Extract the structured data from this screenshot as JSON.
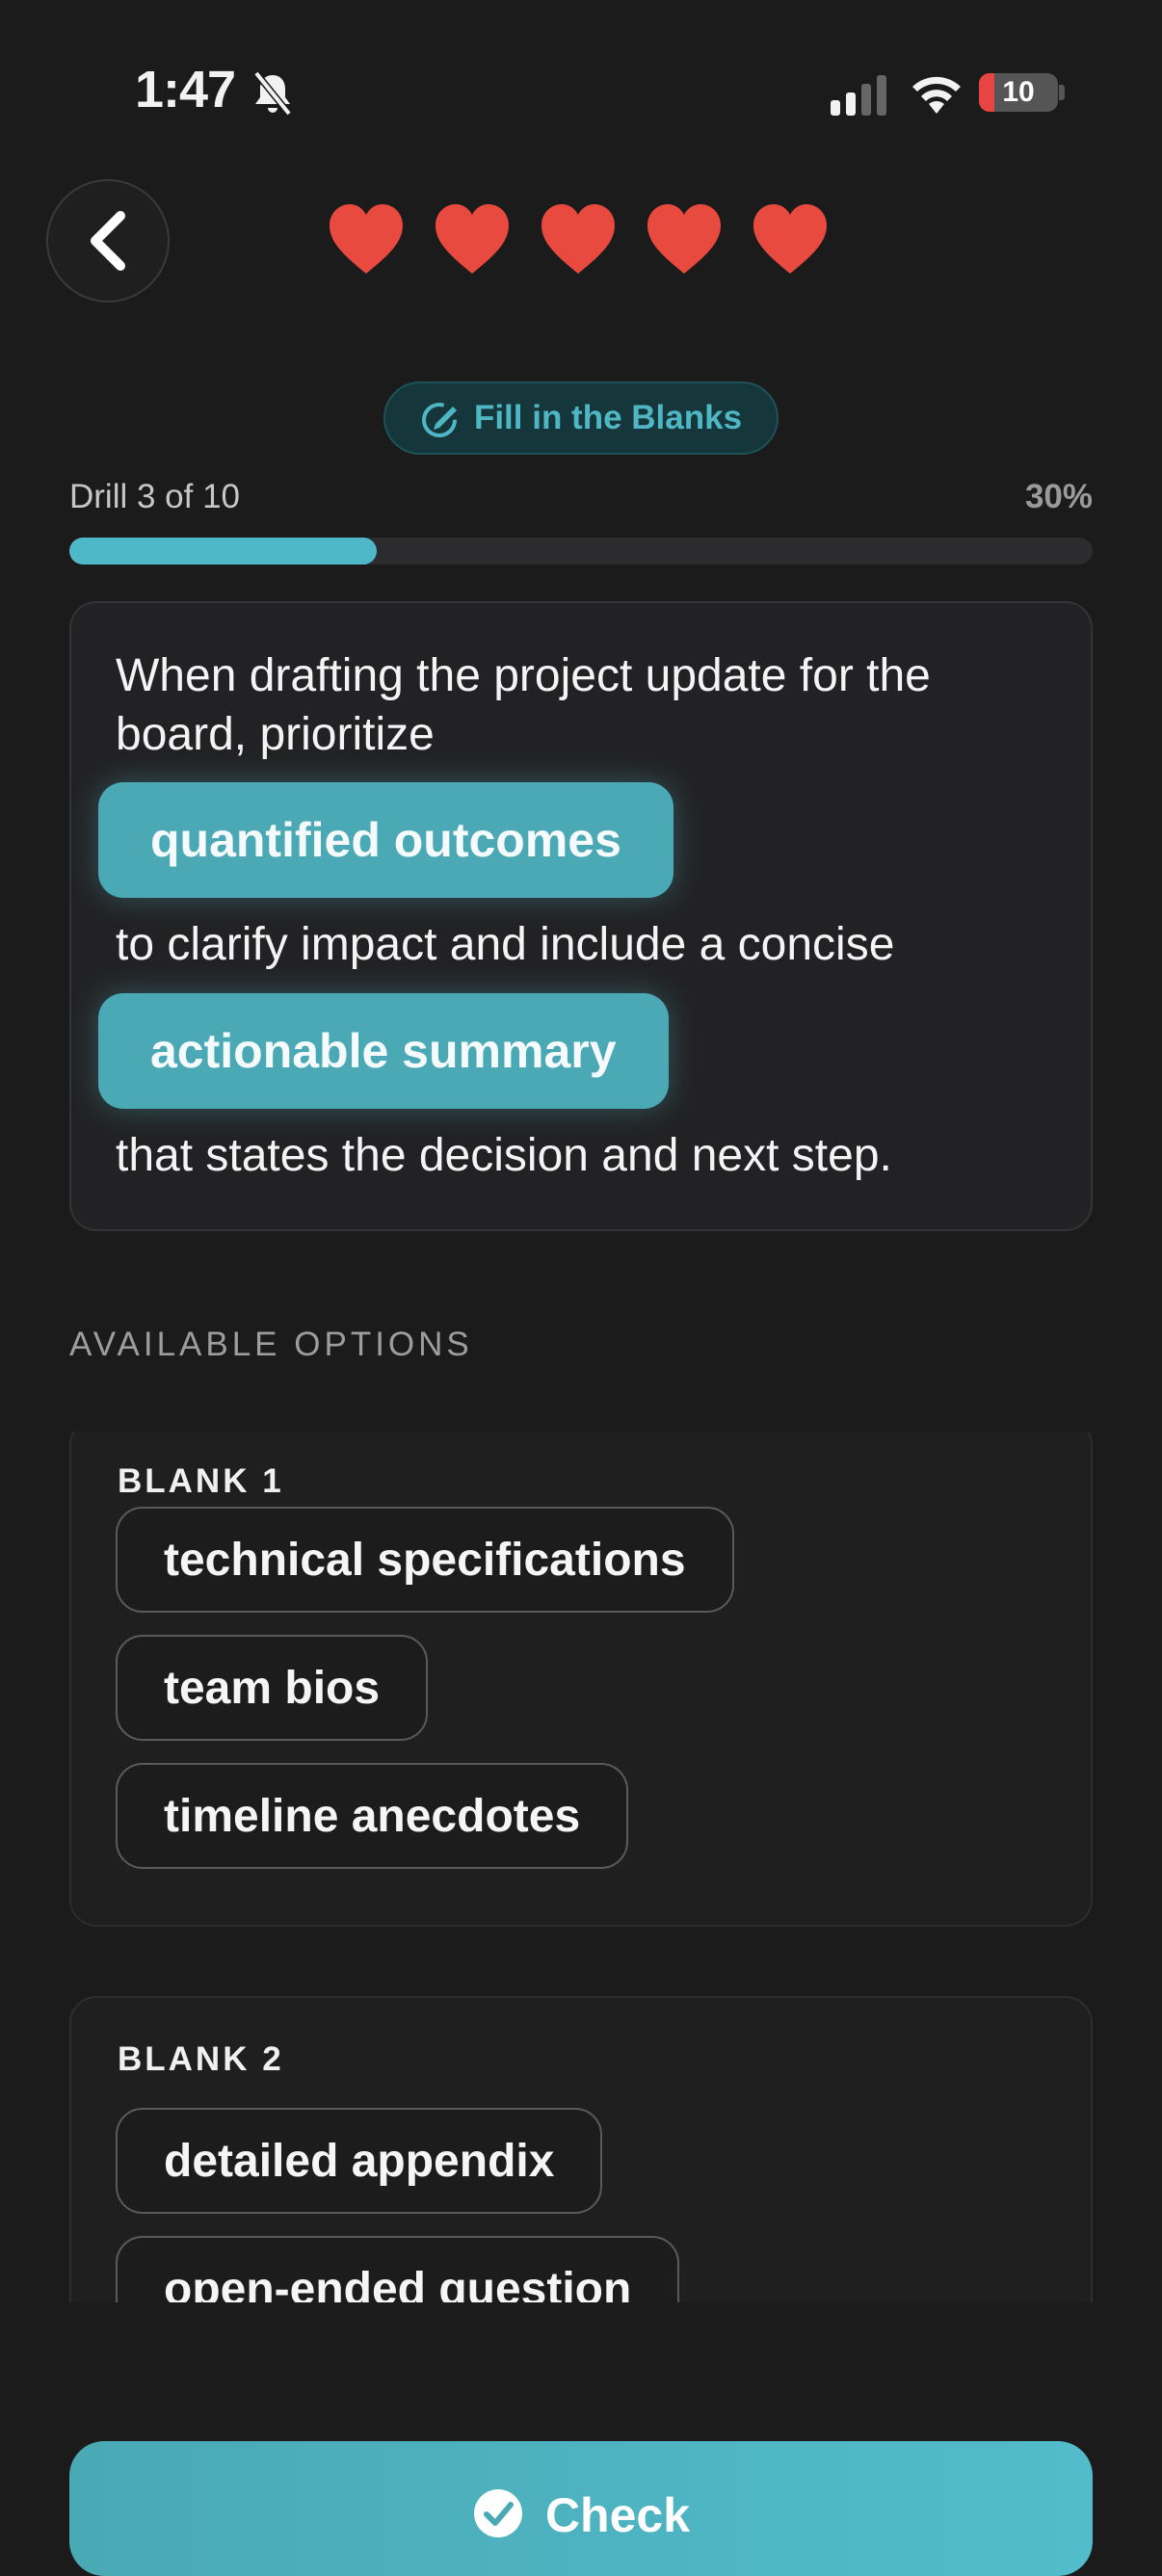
{
  "status_bar": {
    "time": "1:47",
    "battery": "10"
  },
  "header": {
    "lives": 5,
    "heart_color": "#e84a3f"
  },
  "mode": {
    "label": "Fill in the Blanks"
  },
  "progress": {
    "label": "Drill 3 of 10",
    "percent_label": "30%",
    "value": 0.3
  },
  "sentence": {
    "part1_line1": "When drafting the project update for the",
    "part1_line2": "board, prioritize",
    "blank1": "quantified outcomes",
    "part2": "to clarify impact and include a concise",
    "blank2": "actionable summary",
    "part3": "that states the decision and next step."
  },
  "options": {
    "title": "AVAILABLE OPTIONS",
    "blank1": {
      "title": "BLANK 1",
      "choices": [
        "technical specifications",
        "team bios",
        "timeline anecdotes"
      ]
    },
    "blank2": {
      "title": "BLANK 2",
      "choices": [
        "detailed appendix",
        "open-ended question"
      ]
    }
  },
  "footer": {
    "check_label": "Check"
  },
  "colors": {
    "accent": "#4fb8c8",
    "background": "#1b1b1c"
  }
}
